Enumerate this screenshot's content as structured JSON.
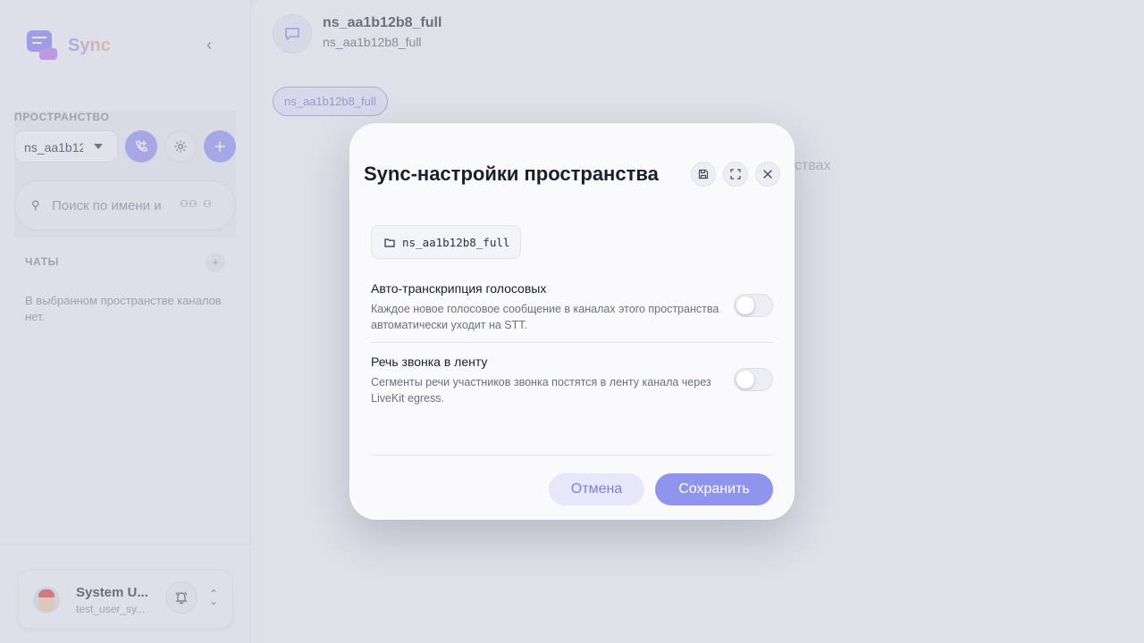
{
  "app": {
    "name": "Sync"
  },
  "sidebar": {
    "space_label": "ПРОСТРАНСТВО",
    "space_selected": "ns_aa1b12b8_full",
    "search_placeholder": "Поиск по имени и",
    "chats_label": "ЧАТЫ",
    "chats_empty": "В выбранном пространстве каналов нет.",
    "user": {
      "name": "System U...",
      "login": "test_user_sy..."
    }
  },
  "channel": {
    "title": "ns_aa1b12b8_full",
    "subtitle": "ns_aa1b12b8_full",
    "chip": "ns_aa1b12b8_full",
    "background_text": "ствах"
  },
  "modal": {
    "title": "Sync-настройки пространства",
    "namespace": "ns_aa1b12b8_full",
    "settings": [
      {
        "title": "Авто-транскрипция голосовых",
        "description": "Каждое новое голосовое сообщение в каналах этого пространства автоматически уходит на STT.",
        "enabled": false
      },
      {
        "title": "Речь звонка в ленту",
        "description": "Сегменты речи участников звонка постятся в ленту канала через LiveKit egress.",
        "enabled": false
      }
    ],
    "cancel_label": "Отмена",
    "save_label": "Сохранить"
  }
}
